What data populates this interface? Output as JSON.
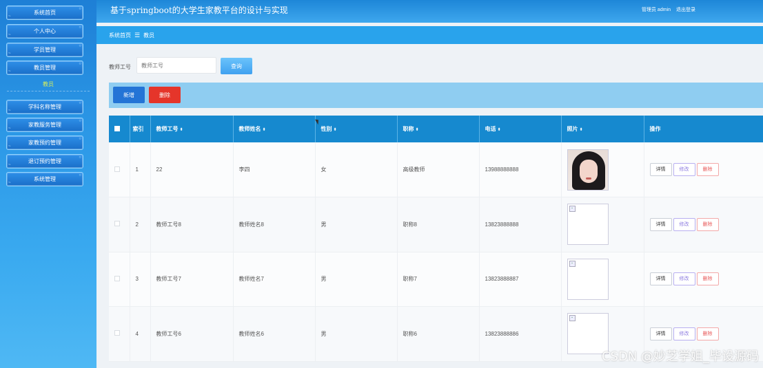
{
  "header": {
    "site_title": "基于springboot的大学生家教平台的设计与实现",
    "admin_label": "管理员 admin",
    "logout_label": "退出登录"
  },
  "sidebar": {
    "items": [
      {
        "label": "系统首页"
      },
      {
        "label": "个人中心"
      },
      {
        "label": "学员管理"
      },
      {
        "label": "教员管理"
      },
      {
        "label": "学科名称管理"
      },
      {
        "label": "家教服务管理"
      },
      {
        "label": "家教预约管理"
      },
      {
        "label": "退订预约管理"
      },
      {
        "label": "系统管理"
      }
    ],
    "active_sub": "教员"
  },
  "breadcrumb": {
    "home": "系统首页",
    "separator": "☰",
    "current": "教员"
  },
  "search": {
    "label": "教师工号",
    "placeholder": "教师工号",
    "button": "查询"
  },
  "actions": {
    "add": "新增",
    "delete": "删除"
  },
  "table": {
    "headers": {
      "index": "索引",
      "teacher_no": "教师工号",
      "teacher_name": "教师姓名",
      "gender": "性别",
      "title": "职称",
      "phone": "电话",
      "photo": "照片",
      "ops": "操作",
      "sort": "⬍"
    },
    "rows": [
      {
        "index": "1",
        "teacher_no": "22",
        "teacher_name": "李四",
        "gender": "女",
        "title": "高级教师",
        "phone": "13988888888"
      },
      {
        "index": "2",
        "teacher_no": "教师工号8",
        "teacher_name": "教师姓名8",
        "gender": "男",
        "title": "职称8",
        "phone": "13823888888"
      },
      {
        "index": "3",
        "teacher_no": "教师工号7",
        "teacher_name": "教师姓名7",
        "gender": "男",
        "title": "职称7",
        "phone": "13823888887"
      },
      {
        "index": "4",
        "teacher_no": "教师工号6",
        "teacher_name": "教师姓名6",
        "gender": "男",
        "title": "职称6",
        "phone": "13823888886"
      }
    ],
    "row_ops": {
      "detail": "详情",
      "edit": "修改",
      "delete": "删除"
    }
  },
  "watermark": "CSDN @妙芝学姐_毕设源码",
  "colors": {
    "header_blue": "#1d86d8",
    "breadcrumb_blue": "#29a3ec",
    "table_head": "#1689cf",
    "add_button": "#2474d6",
    "delete_button": "#e5352a",
    "active_sub": "#d8f05a"
  }
}
